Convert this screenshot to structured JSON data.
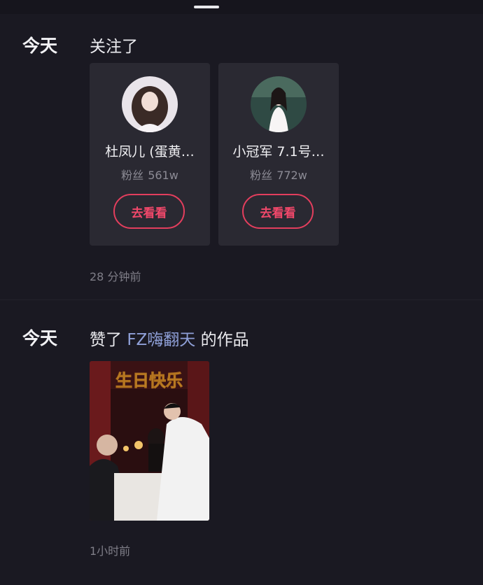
{
  "feed": [
    {
      "day": "今天",
      "action_prefix": "关注了",
      "cards": [
        {
          "name": "杜凤儿 (蛋黄…",
          "fans_label": "粉丝",
          "fans_count": "561w",
          "button": "去看看"
        },
        {
          "name": "小冠军 7.1号…",
          "fans_label": "粉丝",
          "fans_count": "772w",
          "button": "去看看"
        }
      ],
      "time": "28 分钟前"
    },
    {
      "day": "今天",
      "action_prefix": "赞了",
      "action_user": "FZ嗨翻天",
      "action_suffix": "的作品",
      "thumbnail_text": "生日快乐",
      "time": "1小时前"
    }
  ],
  "colors": {
    "background": "#1a1922",
    "card": "#2a2932",
    "accent": "#e33e5d",
    "link": "#8fa0d8"
  }
}
